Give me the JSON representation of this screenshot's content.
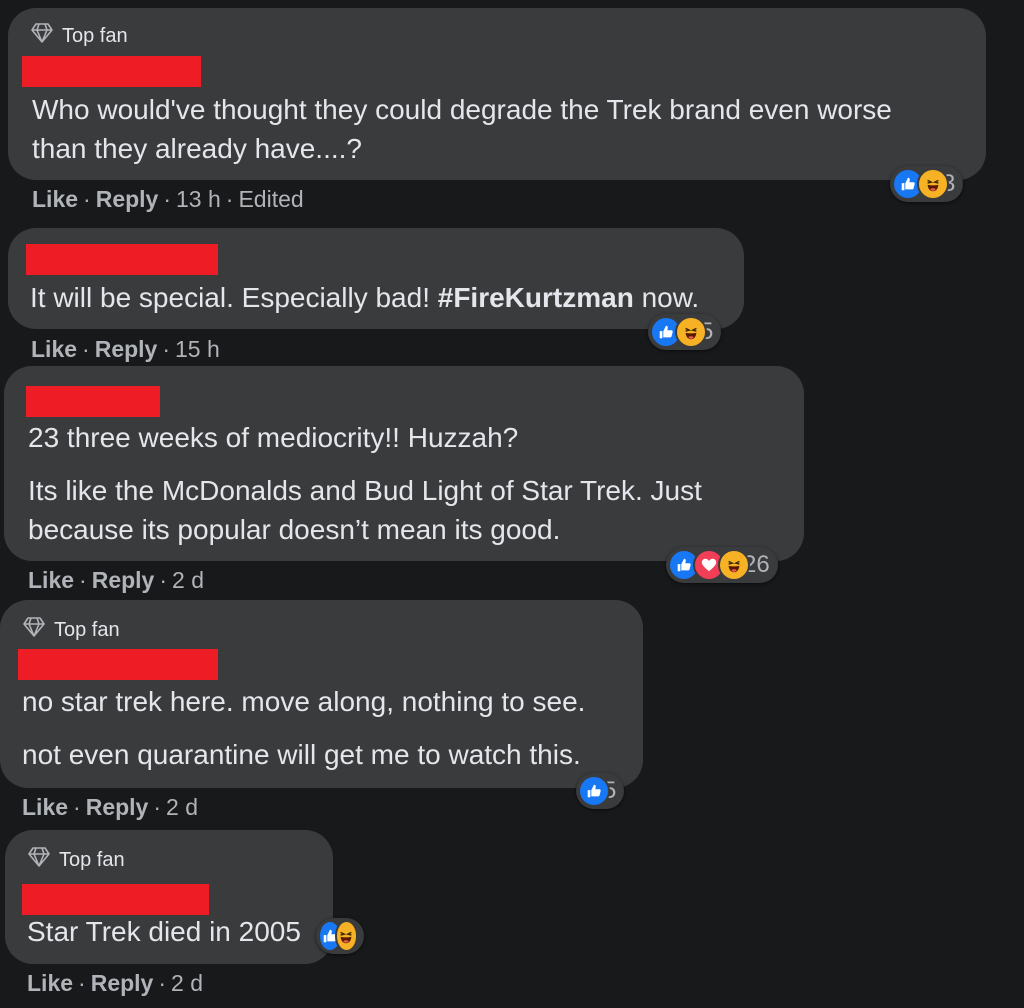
{
  "comments": [
    {
      "badge": "Top fan",
      "lines": [
        "Who would've thought they could degrade the Trek brand even worse",
        "than they already have....?"
      ],
      "reaction_count": "3",
      "reactions": [
        "like-icon",
        "haha-icon"
      ],
      "actions": {
        "like": "Like",
        "reply": "Reply",
        "time": "13 h",
        "edited": "Edited"
      }
    },
    {
      "text_before": "It will be special. Especially bad! ",
      "hashtag": "#FireKurtzman",
      "text_after": " now.",
      "reaction_count": "5",
      "reactions": [
        "like-icon",
        "haha-icon"
      ],
      "actions": {
        "like": "Like",
        "reply": "Reply",
        "time": "15 h"
      }
    },
    {
      "lines": [
        "23 three weeks of mediocrity!! Huzzah?",
        "Its like the McDonalds and Bud Light of Star Trek. Just",
        "because its popular doesn’t mean its good."
      ],
      "reaction_count": "26",
      "reactions": [
        "like-icon",
        "love-icon",
        "haha-icon"
      ],
      "actions": {
        "like": "Like",
        "reply": "Reply",
        "time": "2 d"
      }
    },
    {
      "badge": "Top fan",
      "lines": [
        "no star trek here. move along, nothing to see.",
        "not even quarantine will get me to watch this."
      ],
      "reaction_count": "5",
      "reactions": [
        "like-icon"
      ],
      "actions": {
        "like": "Like",
        "reply": "Reply",
        "time": "2 d"
      }
    },
    {
      "badge": "Top fan",
      "lines": [
        "Star Trek died in 2005"
      ],
      "reactions": [
        "like-icon",
        "haha-icon"
      ],
      "actions": {
        "like": "Like",
        "reply": "Reply",
        "time": "2 d"
      }
    }
  ],
  "separator": "·",
  "colors": {
    "background": "#18191a",
    "bubble": "#3a3b3c",
    "redaction": "#ee1c25",
    "like": "#1877f2",
    "love": "#f33e58",
    "haha": "#f7b125",
    "secondary_text": "#b0b3b8"
  }
}
